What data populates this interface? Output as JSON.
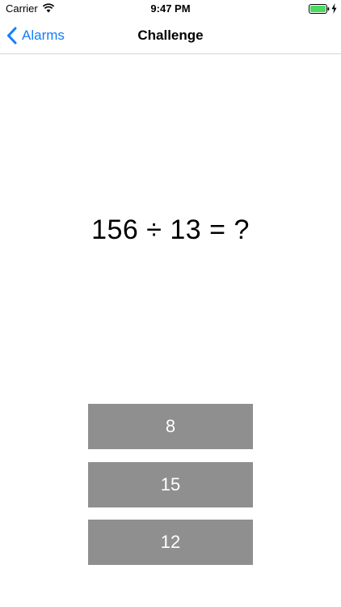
{
  "status_bar": {
    "carrier": "Carrier",
    "time": "9:47 PM",
    "icons": [
      "wifi-icon",
      "battery-icon",
      "charging-icon"
    ],
    "battery_color": "#4cd964"
  },
  "nav_bar": {
    "back_label": "Alarms",
    "title": "Challenge",
    "accent_color": "#157efb",
    "icons": [
      "chevron-left-icon"
    ]
  },
  "challenge": {
    "question": "156 ÷ 13 = ?",
    "answers": [
      "8",
      "15",
      "12"
    ],
    "button_color": "#8f8f8f"
  }
}
